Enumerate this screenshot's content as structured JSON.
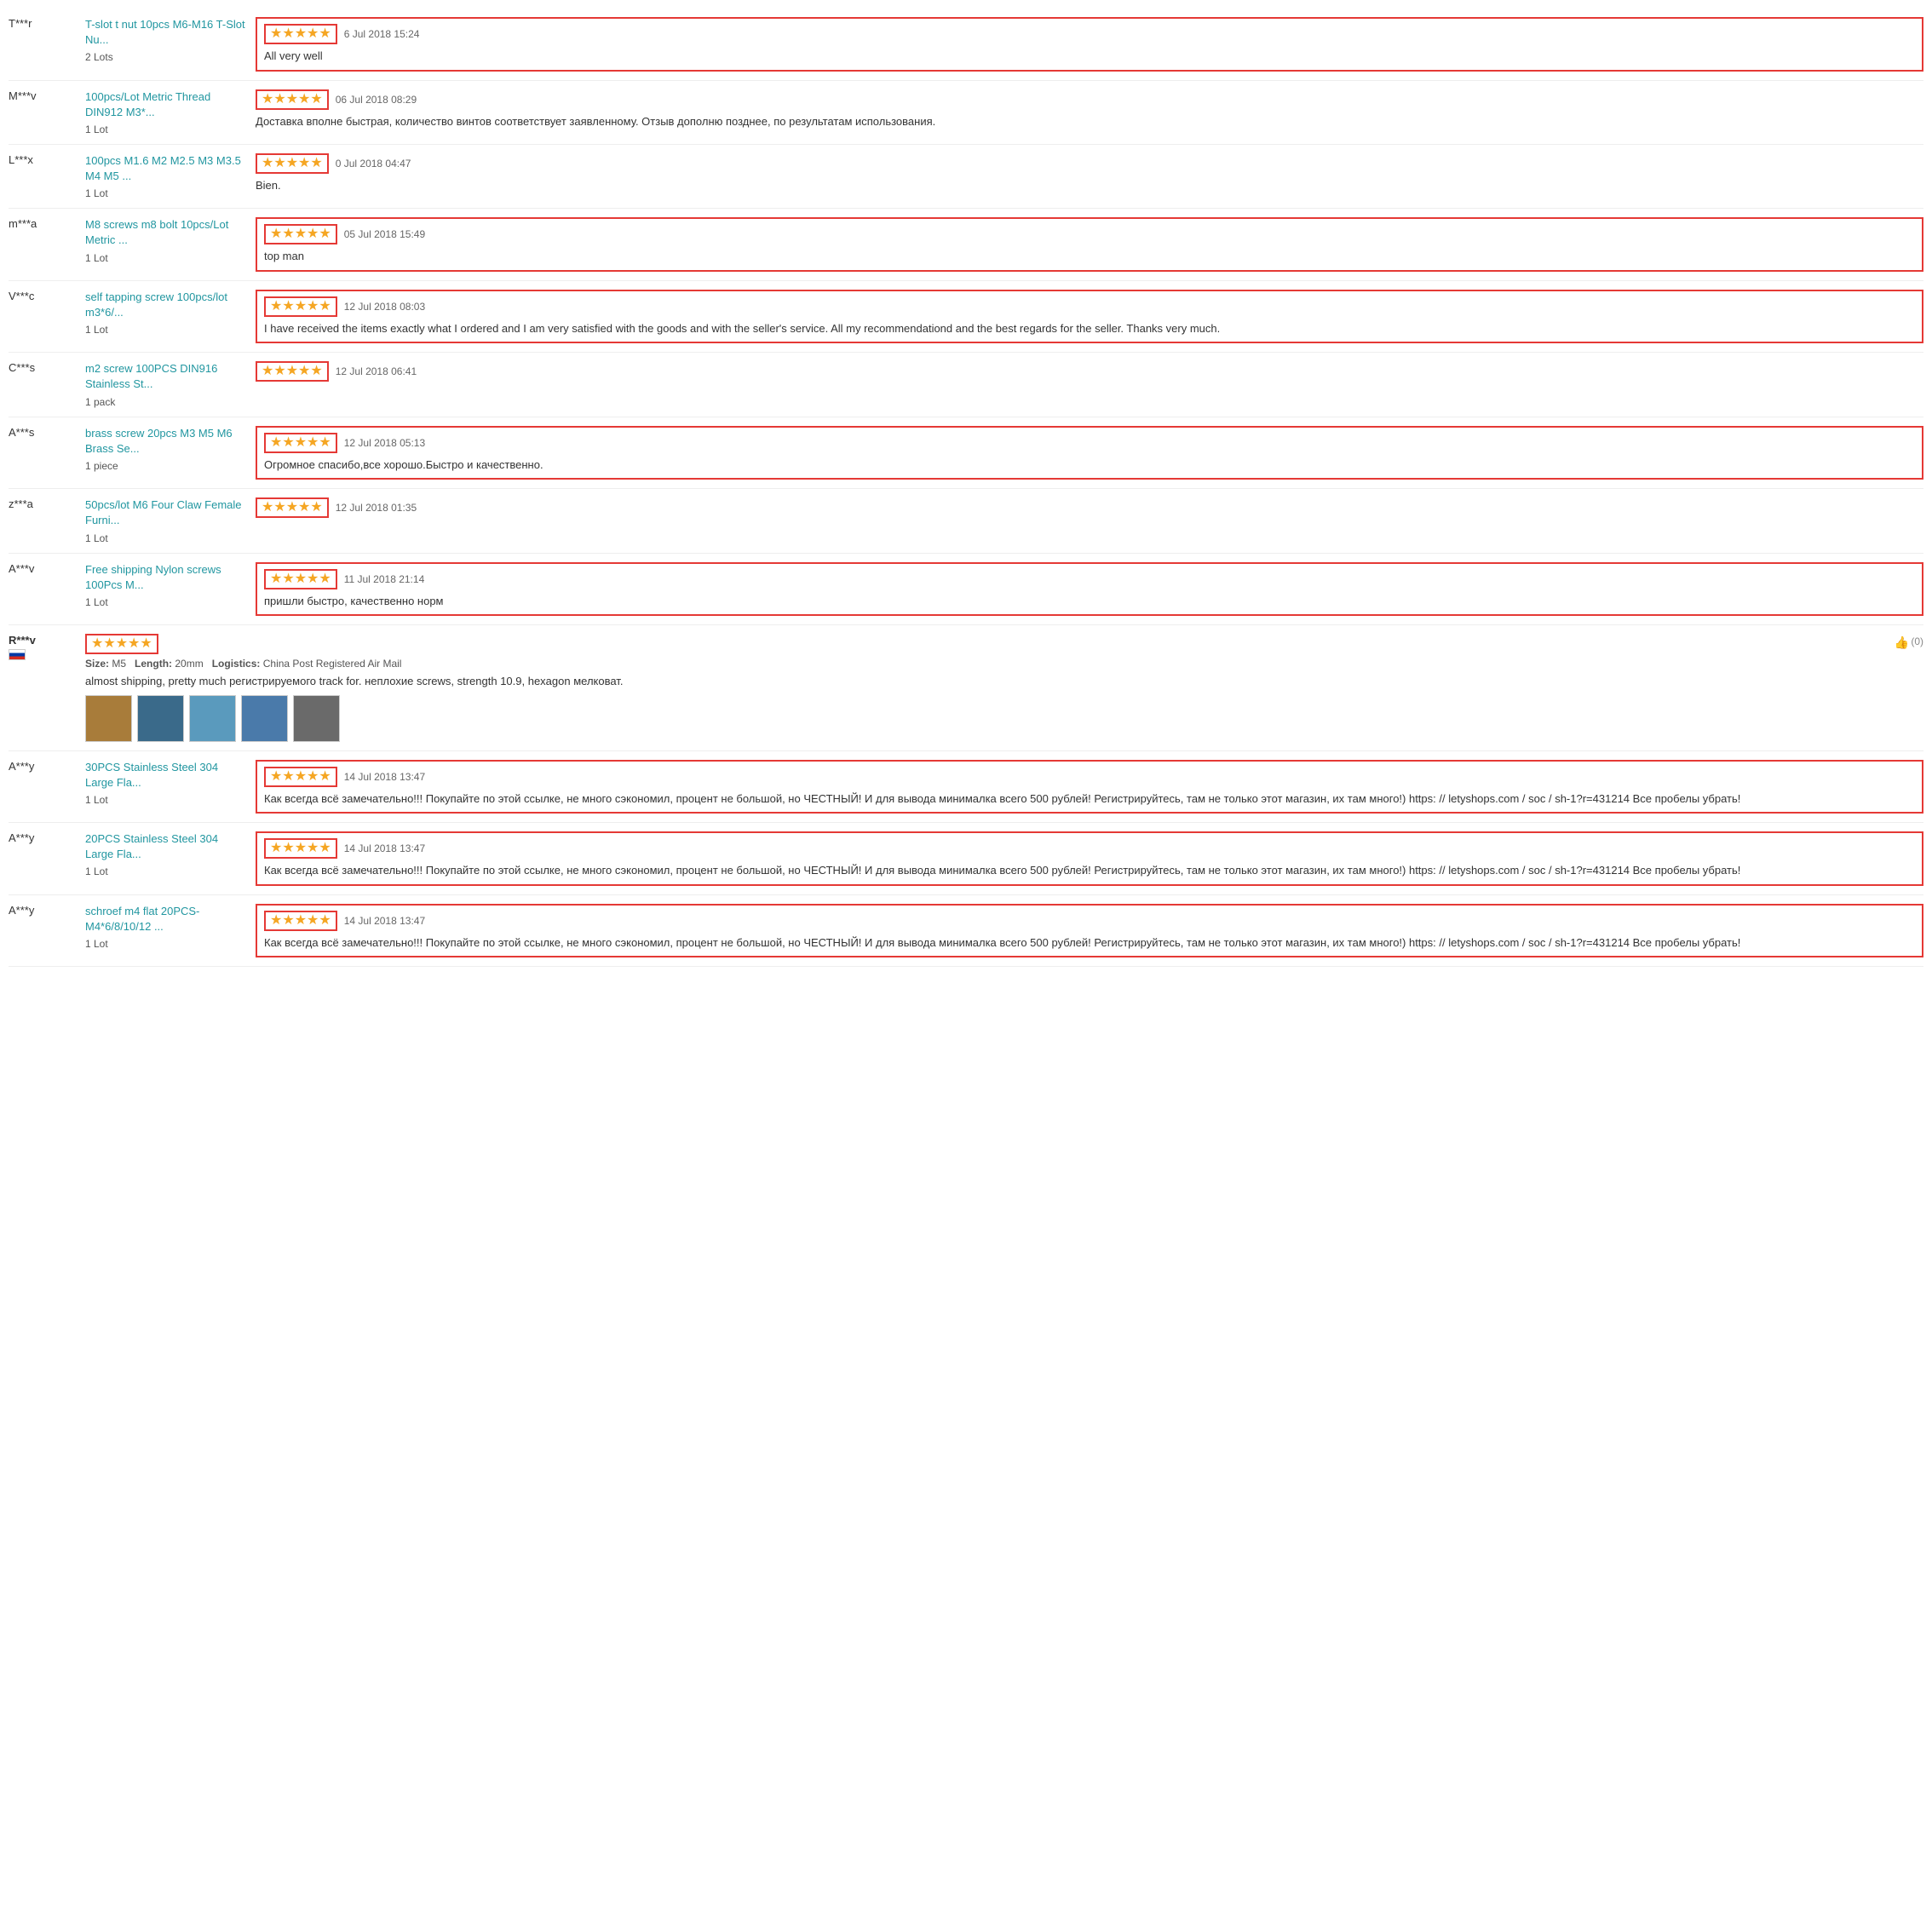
{
  "reviews": [
    {
      "user": "T***r",
      "product_link": "T-slot t nut 10pcs M6-M16 T-Slot Nu...",
      "quantity": "2 Lots",
      "stars": 5,
      "date": "6 Jul 2018 15:24",
      "text": "All very well",
      "has_border": true
    },
    {
      "user": "M***v",
      "product_link": "100pcs/Lot Metric Thread DIN912 M3*...",
      "quantity": "1 Lot",
      "stars": 5,
      "date": "06 Jul 2018 08:29",
      "text": "Доставка вполне быстрая, количество винтов соответствует заявленному. Отзыв дополню позднее, по результатам использования.",
      "has_border": false
    },
    {
      "user": "L***x",
      "product_link": "100pcs M1.6 M2 M2.5 M3 M3.5 M4 M5 ...",
      "quantity": "1 Lot",
      "stars": 5,
      "date": "0  Jul 2018 04:47",
      "text": "Bien.",
      "has_border": false
    },
    {
      "user": "m***a",
      "product_link": "M8 screws m8 bolt 10pcs/Lot Metric ...",
      "quantity": "1 Lot",
      "stars": 5,
      "date": "05 Jul 2018 15:49",
      "text": "top man",
      "has_border": true
    },
    {
      "user": "V***c",
      "product_link": "self tapping screw 100pcs/lot m3*6/...",
      "quantity": "1 Lot",
      "stars": 5,
      "date": "12 Jul 2018 08:03",
      "text": "I have received the items exactly what I ordered and I am very satisfied with the goods and with the seller's service. All my recommendationd and the best regards for the seller. Thanks very much.",
      "has_border": true
    },
    {
      "user": "C***s",
      "product_link": "m2 screw 100PCS DIN916 Stainless St...",
      "quantity": "1 pack",
      "stars": 5,
      "date": "12 Jul 2018 06:41",
      "text": "",
      "has_border": false
    },
    {
      "user": "A***s",
      "product_link": "brass screw 20pcs M3 M5 M6 Brass Se...",
      "quantity": "1 piece",
      "stars": 5,
      "date": "12 Jul 2018 05:13",
      "text": "Огромное спасибо,все хорошо.Быстро и качественно.",
      "has_border": true
    },
    {
      "user": "z***a",
      "product_link": "50pcs/lot M6 Four Claw Female Furni...",
      "quantity": "1 Lot",
      "stars": 5,
      "date": "12 Jul 2018 01:35",
      "text": "",
      "has_border": false
    },
    {
      "user": "A***v",
      "product_link": "Free shipping Nylon screws 100Pcs M...",
      "quantity": "1 Lot",
      "stars": 5,
      "date": "11 Jul 2018 21:14",
      "text": "пришли быстро, качественно норм",
      "has_border": true
    }
  ],
  "special_review": {
    "user": "R***v",
    "flag": "RU",
    "stars": 5,
    "size": "M5",
    "length": "20mm",
    "logistics": "China Post Registered Air Mail",
    "text": "almost shipping, pretty much регистрируемого track for. неплохие screws, strength 10.9, hexagon мелковат.",
    "thumbs": "(0)",
    "images": [
      "img1",
      "img2",
      "img3",
      "img4",
      "img5"
    ]
  },
  "big_reviews": [
    {
      "user": "A***y",
      "product_link": "30PCS Stainless Steel 304 Large Fla...",
      "quantity": "1 Lot",
      "stars": 5,
      "date": "14 Jul 2018 13:47",
      "text": "Как всегда всё замечательно!!! Покупайте по этой ссылке, не много сэкономил, процент не большой, но ЧЕСТНЫЙ! И для вывода минималка всего 500 рублей! Регистрируйтесь, там не только этот магазин, их там много!) https: // letyshops.com / soc / sh-1?r=431214 Все пробелы убрать!",
      "has_border": true
    },
    {
      "user": "A***y",
      "product_link": "20PCS Stainless Steel 304 Large Fla...",
      "quantity": "1 Lot",
      "stars": 5,
      "date": "14 Jul 2018 13:47",
      "text": "Как всегда всё замечательно!!! Покупайте по этой ссылке, не много сэкономил, процент не большой, но ЧЕСТНЫЙ! И для вывода минималка всего 500 рублей! Регистрируйтесь, там не только этот магазин, их там много!) https: // letyshops.com / soc / sh-1?r=431214 Все пробелы убрать!",
      "has_border": true
    },
    {
      "user": "A***y",
      "product_link": "schroef m4 flat 20PCS-M4*6/8/10/12 ...",
      "quantity": "1 Lot",
      "stars": 5,
      "date": "14 Jul 2018 13:47",
      "text": "Как всегда всё замечательно!!! Покупайте по этой ссылке, не много сэкономил, процент не большой, но ЧЕСТНЫЙ! И для вывода минималка всего 500 рублей! Регистрируйтесь, там не только этот магазин, их там много!) https: // letyshops.com / soc / sh-1?r=431214 Все пробелы убрать!",
      "has_border": true
    }
  ],
  "labels": {
    "size": "Size:",
    "length": "Length:",
    "logistics": "Logistics:"
  }
}
